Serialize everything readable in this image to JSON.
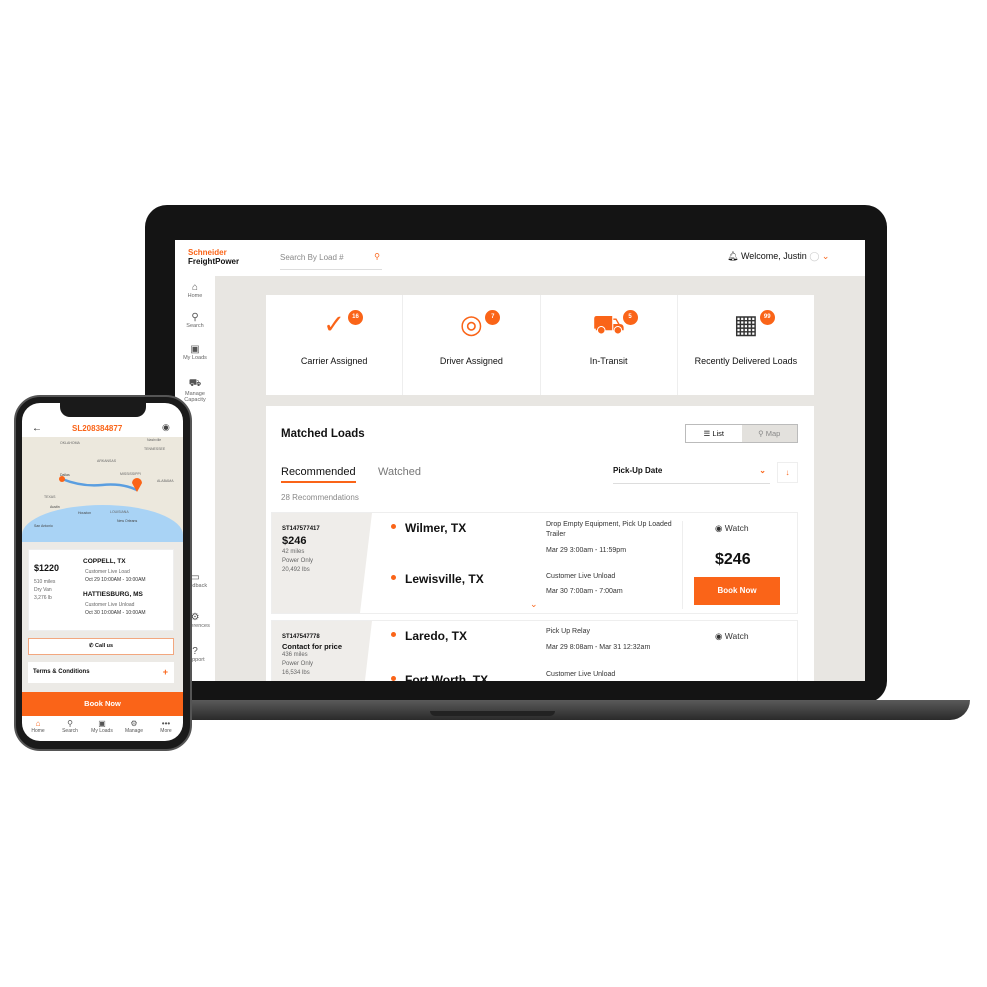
{
  "laptop": {
    "logo": {
      "line1": "Schneider",
      "line2": "FreightPower"
    },
    "search_placeholder": "Search By Load #",
    "welcome": "Welcome, Justin",
    "sidebar": [
      {
        "label": "Home",
        "icon": "home-icon"
      },
      {
        "label": "Search",
        "icon": "search-icon"
      },
      {
        "label": "My Loads",
        "icon": "loads-icon"
      },
      {
        "label": "Manage Capacity",
        "icon": "truck-icon"
      },
      {
        "label": "Feedback",
        "icon": "feedback-icon"
      },
      {
        "label": "Preferences",
        "icon": "gear-icon"
      },
      {
        "label": "Support",
        "icon": "help-icon"
      }
    ],
    "stats": [
      {
        "label": "Carrier Assigned",
        "count": "16",
        "icon": "clipboard-check-icon"
      },
      {
        "label": "Driver Assigned",
        "count": "7",
        "icon": "steering-wheel-icon"
      },
      {
        "label": "In-Transit",
        "count": "5",
        "icon": "truck-icon"
      },
      {
        "label": "Recently Delivered Loads",
        "count": "99",
        "icon": "pallet-icon"
      }
    ],
    "matched": {
      "title": "Matched Loads",
      "view_list": "List",
      "view_map": "Map",
      "tabs": [
        "Recommended",
        "Watched"
      ],
      "sort": "Pick-Up Date",
      "count_text": "28 Recommendations",
      "loads": [
        {
          "id": "ST147577417",
          "price": "$246",
          "miles": "42 miles",
          "type": "Power Only",
          "weight": "20,492 lbs",
          "origin": "Wilmer, TX",
          "origin_info": "Drop Empty Equipment, Pick Up Loaded Trailer",
          "origin_time": "Mar 29 3:00am - 11:59pm",
          "dest": "Lewisville, TX",
          "dest_info": "Customer Live Unload",
          "dest_time": "Mar 30 7:00am - 7:00am",
          "watch": "Watch",
          "big_price": "$246",
          "book": "Book Now"
        },
        {
          "id": "ST147547778",
          "price": "Contact for price",
          "miles": "436 miles",
          "type": "Power Only",
          "weight": "16,534 lbs",
          "origin": "Laredo, TX",
          "origin_info": "Pick Up Relay",
          "origin_time": "Mar 29 8:08am - Mar 31 12:32am",
          "dest": "Fort Worth, TX",
          "dest_info": "Customer Live Unload",
          "watch": "Watch"
        }
      ]
    }
  },
  "phone": {
    "load_id": "SL208384877",
    "map_labels": [
      "OKLAHOMA",
      "ARKANSAS",
      "TENNESSEE",
      "Nashville",
      "MISSISSIPPI",
      "ALABAMA",
      "Dallas",
      "TEXAS",
      "Austin",
      "Houston",
      "LOUISIANA",
      "New Orleans",
      "San Antonio"
    ],
    "price": "$1220",
    "miles": "510 miles",
    "equipment": "Dry Van",
    "weight": "3,276 lb",
    "origin": "COPPELL, TX",
    "origin_info": "Customer Live Load",
    "origin_time": "Oct 29 10:00AM - 10:00AM",
    "dest": "HATTIESBURG, MS",
    "dest_info": "Customer Live Unload",
    "dest_time": "Oct 30 10:00AM - 10:00AM",
    "call": "Call us",
    "terms": "Terms & Conditions",
    "book": "Book Now",
    "tabs": [
      "Home",
      "Search",
      "My Loads",
      "Manage",
      "More"
    ]
  },
  "colors": {
    "accent": "#fa6418",
    "background": "#e8e6e2"
  }
}
